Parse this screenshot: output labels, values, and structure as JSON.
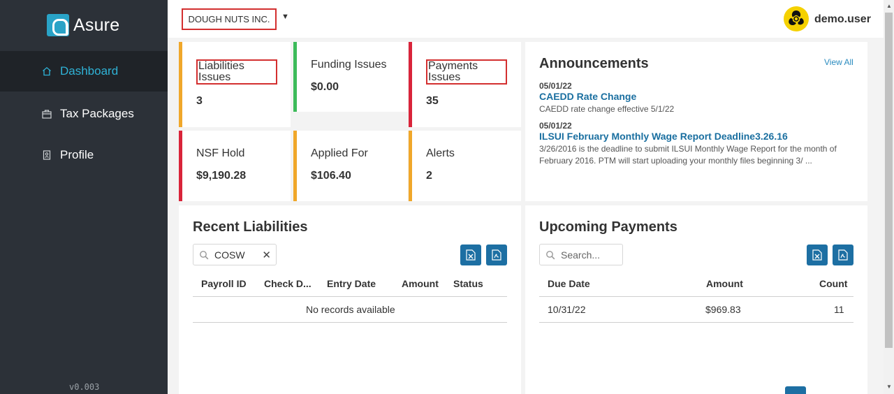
{
  "app": {
    "brand": "Asure",
    "version": "v0.003"
  },
  "sidebar": {
    "items": [
      {
        "label": "Dashboard",
        "icon": "home-icon",
        "active": true
      },
      {
        "label": "Tax Packages",
        "icon": "briefcase-icon",
        "active": false
      },
      {
        "label": "Profile",
        "icon": "badge-icon",
        "active": false
      }
    ]
  },
  "header": {
    "company": "DOUGH NUTS INC.",
    "username": "demo.user",
    "avatar_icon": "biohazard-icon"
  },
  "stats": [
    {
      "label": "Liabilities Issues",
      "value": "3",
      "color": "#f0a72a"
    },
    {
      "label": "Funding Issues",
      "value": "$0.00",
      "color": "#3dbb5a"
    },
    {
      "label": "Payments Issues",
      "value": "35",
      "color": "#d9243a"
    },
    {
      "label": "NSF Hold",
      "value": "$9,190.28",
      "color": "#d9243a"
    },
    {
      "label": "Applied For",
      "value": "$106.40",
      "color": "#f0a72a"
    },
    {
      "label": "Alerts",
      "value": "2",
      "color": "#f0a72a"
    }
  ],
  "announcements": {
    "title": "Announcements",
    "view_all": "View All",
    "items": [
      {
        "date": "05/01/22",
        "title": "CAEDD Rate Change",
        "text": "CAEDD rate change effective 5/1/22"
      },
      {
        "date": "05/01/22",
        "title": "ILSUI February Monthly Wage Report Deadline3.26.16",
        "text": "3/26/2016 is the deadline to submit ILSUI Monthly Wage Report for the month of February 2016. PTM will start uploading your monthly files beginning 3/ ..."
      }
    ]
  },
  "recent_liabilities": {
    "title": "Recent Liabilities",
    "search_value": "COSW",
    "columns": [
      "Payroll ID",
      "Check D...",
      "Entry Date",
      "Amount",
      "Status"
    ],
    "empty_text": "No records available"
  },
  "upcoming_payments": {
    "title": "Upcoming Payments",
    "search_placeholder": "Search...",
    "columns": [
      "Due Date",
      "Amount",
      "Count"
    ],
    "rows": [
      {
        "due_date": "10/31/22",
        "amount": "$969.83",
        "count": "11"
      }
    ]
  },
  "colors": {
    "accent": "#2fb2d6",
    "brand_blue": "#1d6fa3",
    "alert_red": "#d32f2f"
  }
}
